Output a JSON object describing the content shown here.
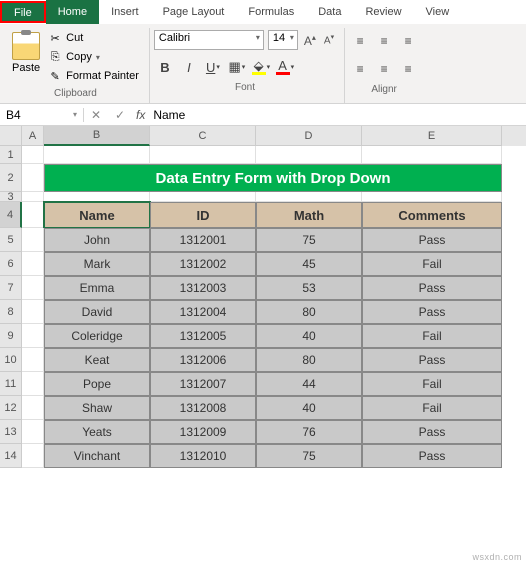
{
  "tabs": [
    "File",
    "Home",
    "Insert",
    "Page Layout",
    "Formulas",
    "Data",
    "Review",
    "View"
  ],
  "clipboard": {
    "paste": "Paste",
    "cut": "Cut",
    "copy": "Copy",
    "format_painter": "Format Painter",
    "label": "Clipboard"
  },
  "font": {
    "name": "Calibri",
    "size": "14",
    "label": "Font"
  },
  "alignment": {
    "label": "Alignr"
  },
  "name_box": "B4",
  "formula_value": "Name",
  "col_headers": [
    "A",
    "B",
    "C",
    "D",
    "E"
  ],
  "banner": "Data Entry Form with Drop Down",
  "table": {
    "headers": [
      "Name",
      "ID",
      "Math",
      "Comments"
    ],
    "rows": [
      [
        "John",
        "1312001",
        "75",
        "Pass"
      ],
      [
        "Mark",
        "1312002",
        "45",
        "Fail"
      ],
      [
        "Emma",
        "1312003",
        "53",
        "Pass"
      ],
      [
        "David",
        "1312004",
        "80",
        "Pass"
      ],
      [
        "Coleridge",
        "1312005",
        "40",
        "Fail"
      ],
      [
        "Keat",
        "1312006",
        "80",
        "Pass"
      ],
      [
        "Pope",
        "1312007",
        "44",
        "Fail"
      ],
      [
        "Shaw",
        "1312008",
        "40",
        "Fail"
      ],
      [
        "Yeats",
        "1312009",
        "76",
        "Pass"
      ],
      [
        "Vinchant",
        "1312010",
        "75",
        "Pass"
      ]
    ]
  },
  "watermark": "wsxdn.com"
}
